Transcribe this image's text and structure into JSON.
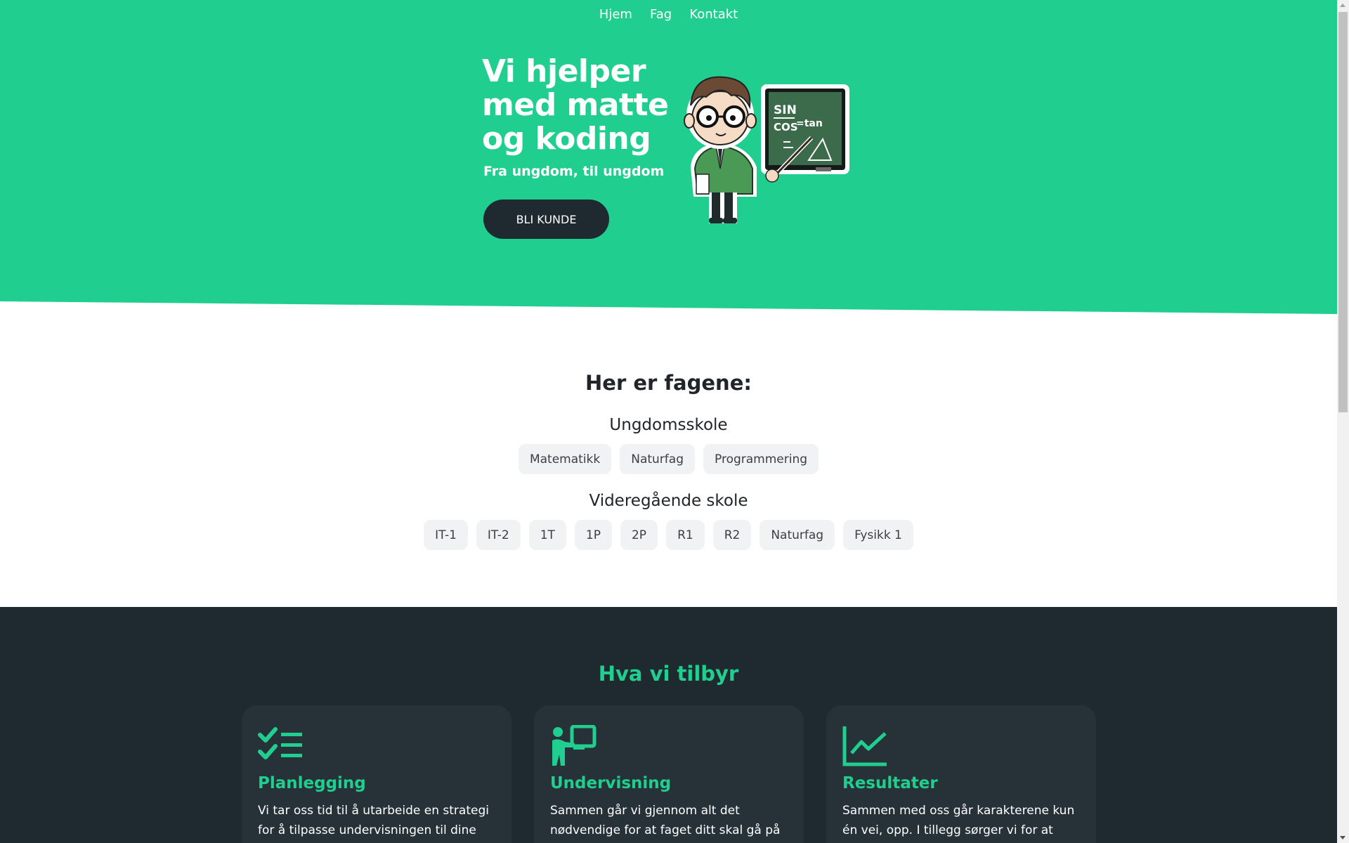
{
  "nav": {
    "items": [
      "Hjem",
      "Fag",
      "Kontakt"
    ]
  },
  "hero": {
    "title_lines": [
      "Vi hjelper",
      "med matte",
      "og koding"
    ],
    "subtitle": "Fra ungdom, til ungdom",
    "cta": "BLI KUNDE",
    "mascot": {
      "board_text_1": "SIN",
      "board_text_2": "COS",
      "board_text_3": "=tan"
    }
  },
  "subjects": {
    "title": "Her er fagene:",
    "levels": [
      {
        "name": "Ungdomsskole",
        "items": [
          "Matematikk",
          "Naturfag",
          "Programmering"
        ]
      },
      {
        "name": "Videregående skole",
        "items": [
          "IT-1",
          "IT-2",
          "1T",
          "1P",
          "2P",
          "R1",
          "R2",
          "Naturfag",
          "Fysikk 1"
        ]
      }
    ]
  },
  "offer": {
    "title": "Hva vi tilbyr",
    "cards": [
      {
        "icon": "checklist-icon",
        "title": "Planlegging",
        "text": "Vi tar oss tid til å utarbeide en strategi for å tilpasse undervisningen til dine behov"
      },
      {
        "icon": "teacher-board-icon",
        "title": "Undervisning",
        "text": "Sammen går vi gjennom alt det nødvendige for at faget ditt skal gå på"
      },
      {
        "icon": "line-chart-icon",
        "title": "Resultater",
        "text": "Sammen med oss går karakterene kun én vei, opp. I tillegg sørger vi for at"
      }
    ]
  },
  "colors": {
    "accent": "#20cf8f",
    "dark": "#1e2a2f",
    "card": "#263237",
    "chip": "#f1f2f3"
  }
}
